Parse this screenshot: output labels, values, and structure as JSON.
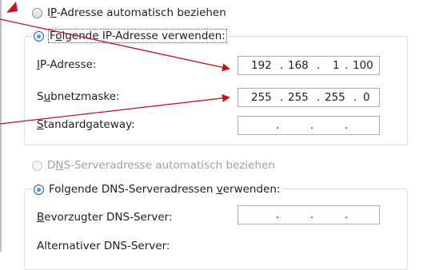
{
  "ip_section": {
    "auto_label_pre": "I",
    "auto_label_key": "P",
    "auto_label_post": "-Adresse automatisch beziehen",
    "manual_label_pre": "F",
    "manual_label_key": "o",
    "manual_label_post": "lgende IP-Adresse verwenden:",
    "fields": [
      {
        "pre": "",
        "key": "I",
        "post": "P-Adresse:",
        "octets": [
          "192",
          "168",
          "1",
          "100"
        ],
        "dots": [
          ".",
          ".",
          "."
        ]
      },
      {
        "pre": "S",
        "key": "u",
        "post": "bnetzmaske:",
        "octets": [
          "255",
          "255",
          "255",
          "0"
        ],
        "dots": [
          ".",
          ".",
          "."
        ]
      },
      {
        "pre": "",
        "key": "S",
        "post": "tandardgateway:",
        "octets": [
          "",
          "",
          "",
          ""
        ],
        "dots": [
          ".",
          ".",
          "."
        ]
      }
    ]
  },
  "dns_section": {
    "auto_label_pre": "D",
    "auto_label_key": "N",
    "auto_label_post": "S-Serveradresse automatisch beziehen",
    "manual_label_pre": "Folgende DNS-Serveradressen ",
    "manual_label_key": "v",
    "manual_label_post": "erwenden:",
    "fields": [
      {
        "pre": "",
        "key": "B",
        "post": "evorzugter DNS-Server:",
        "octets": [
          "",
          "",
          "",
          ""
        ],
        "dots": [
          ".",
          ".",
          "."
        ]
      },
      {
        "pre": "A",
        "key": "",
        "post": "lternativer DNS-Server:"
      }
    ]
  },
  "annotation": {
    "arrow_color": "#c8101e"
  }
}
